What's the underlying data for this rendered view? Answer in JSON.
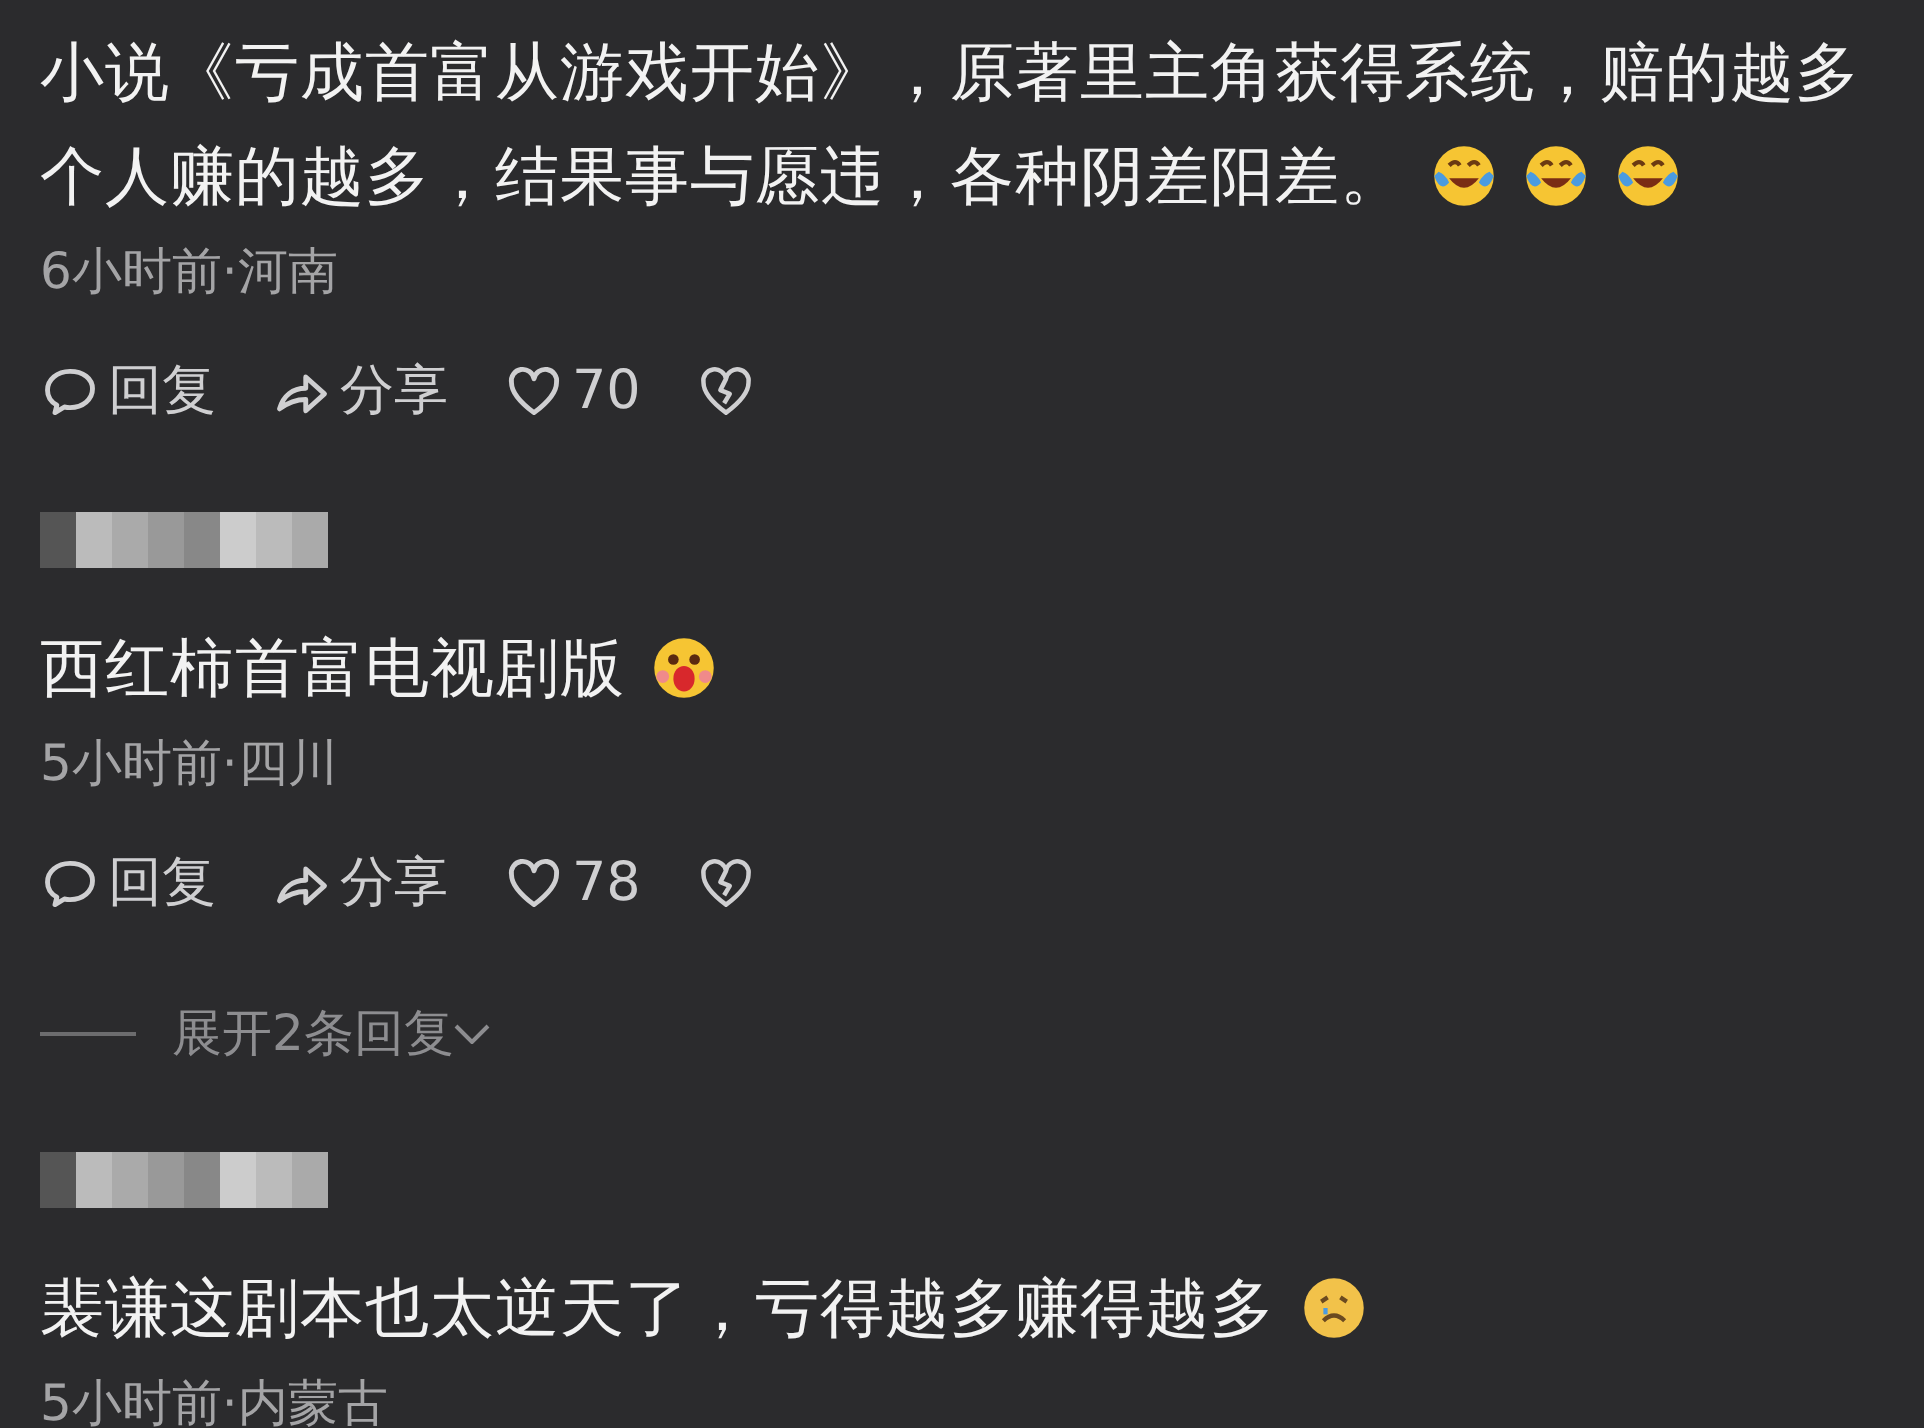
{
  "comments": [
    {
      "username_blurred": false,
      "text": "小说《亏成首富从游戏开始》，原著里主角获得系统，赔的越多个人赚的越多，结果事与愿违，各种阴差阳差。",
      "emojis": [
        {
          "kind": "tears-of-joy"
        },
        {
          "kind": "tears-of-joy"
        },
        {
          "kind": "tears-of-joy"
        }
      ],
      "meta": "6小时前·河南",
      "actions": {
        "reply": "回复",
        "share": "分享",
        "likes": "70"
      }
    },
    {
      "username_blurred": true,
      "text": "西红柿首富电视剧版",
      "emojis": [
        {
          "kind": "shocked"
        }
      ],
      "meta": "5小时前·四川",
      "actions": {
        "reply": "回复",
        "share": "分享",
        "likes": "78"
      },
      "expand": "展开2条回复"
    },
    {
      "username_blurred": true,
      "text": "裴谦这剧本也太逆天了，亏得越多赚得越多",
      "emojis": [
        {
          "kind": "sad"
        }
      ],
      "meta": "5小时前·内蒙古"
    }
  ]
}
